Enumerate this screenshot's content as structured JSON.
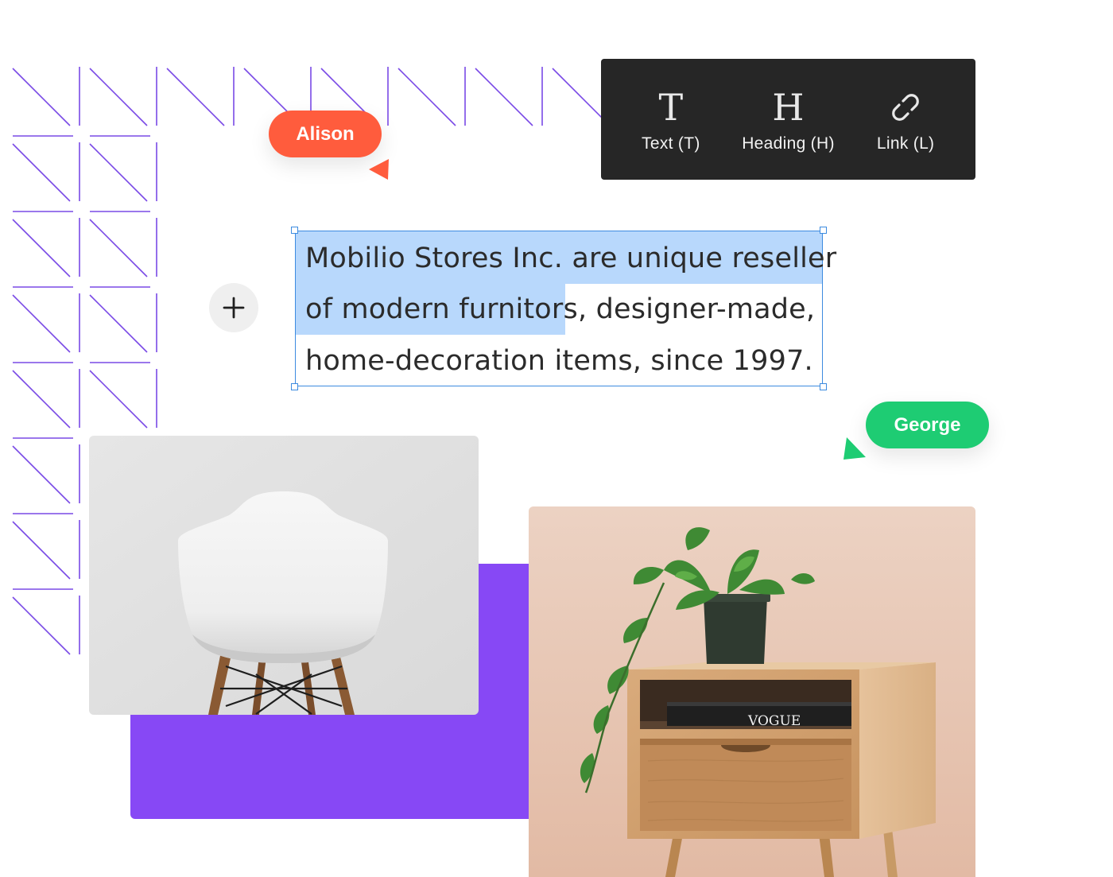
{
  "toolbar": {
    "items": [
      {
        "label": "Text (T)",
        "icon": "text-icon"
      },
      {
        "label": "Heading (H)",
        "icon": "heading-icon"
      },
      {
        "label": "Link (L)",
        "icon": "link-icon"
      }
    ]
  },
  "collaborators": {
    "alison": {
      "name": "Alison",
      "color": "#ff5c3d"
    },
    "george": {
      "name": "George",
      "color": "#1ecc73"
    }
  },
  "editor": {
    "line1_selected": "Mobilio Stores Inc. are unique reseller",
    "line2_selected": "of modern furnitors,",
    "line2_rest": " designer-made,",
    "line3": "home-decoration items, since 1997."
  },
  "images": {
    "magazine_text": "VOGUE"
  },
  "colors": {
    "accent_purple": "#8748f5",
    "selection": "#b8d8fc",
    "frame_blue": "#3c8be0"
  }
}
